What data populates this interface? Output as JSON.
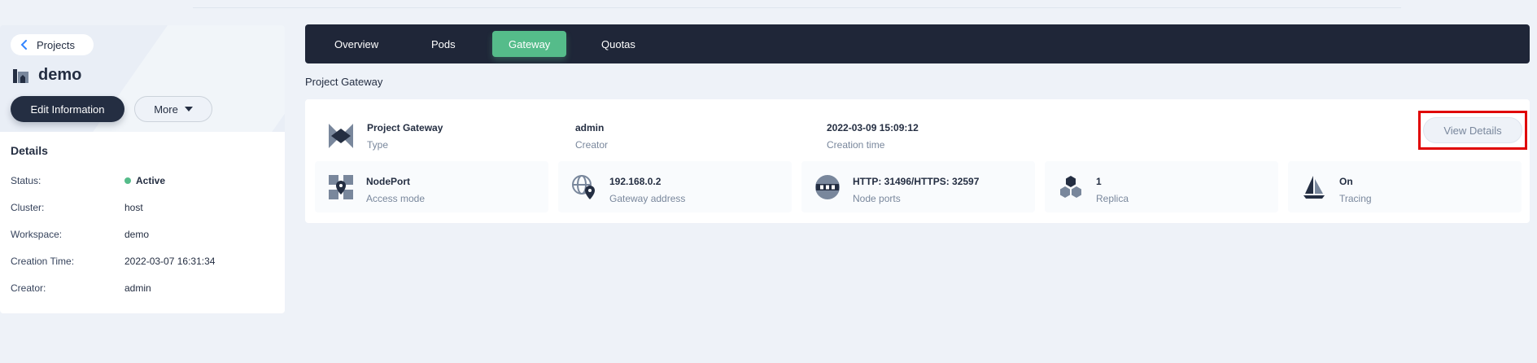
{
  "sidebar": {
    "back_label": "Projects",
    "project_name": "demo",
    "edit_button": "Edit Information",
    "more_button": "More",
    "details_title": "Details",
    "details": [
      {
        "key": "Status:",
        "value": "Active"
      },
      {
        "key": "Cluster:",
        "value": "host"
      },
      {
        "key": "Workspace:",
        "value": "demo"
      },
      {
        "key": "Creation Time:",
        "value": "2022-03-07 16:31:34"
      },
      {
        "key": "Creator:",
        "value": "admin"
      }
    ],
    "status_color": "#55bc8a"
  },
  "tabs": [
    {
      "label": "Overview",
      "active": false
    },
    {
      "label": "Pods",
      "active": false
    },
    {
      "label": "Gateway",
      "active": true
    },
    {
      "label": "Quotas",
      "active": false
    }
  ],
  "section_title": "Project Gateway",
  "gateway": {
    "type_value": "Project Gateway",
    "type_label": "Type",
    "creator_value": "admin",
    "creator_label": "Creator",
    "time_value": "2022-03-09 15:09:12",
    "time_label": "Creation time",
    "view_details": "View Details",
    "stats": [
      {
        "icon": "nodeport-icon",
        "value": "NodePort",
        "label": "Access mode"
      },
      {
        "icon": "globe-location-icon",
        "value": "192.168.0.2",
        "label": "Gateway address"
      },
      {
        "icon": "network-ports-icon",
        "value": "HTTP: 31496/HTTPS: 32597",
        "label": "Node ports"
      },
      {
        "icon": "hexagon-cluster-icon",
        "value": "1",
        "label": "Replica"
      },
      {
        "icon": "sailboat-icon",
        "value": "On",
        "label": "Tracing"
      }
    ]
  },
  "colors": {
    "accent": "#55bc8a",
    "dark": "#242e42",
    "highlight": "#e00000"
  }
}
